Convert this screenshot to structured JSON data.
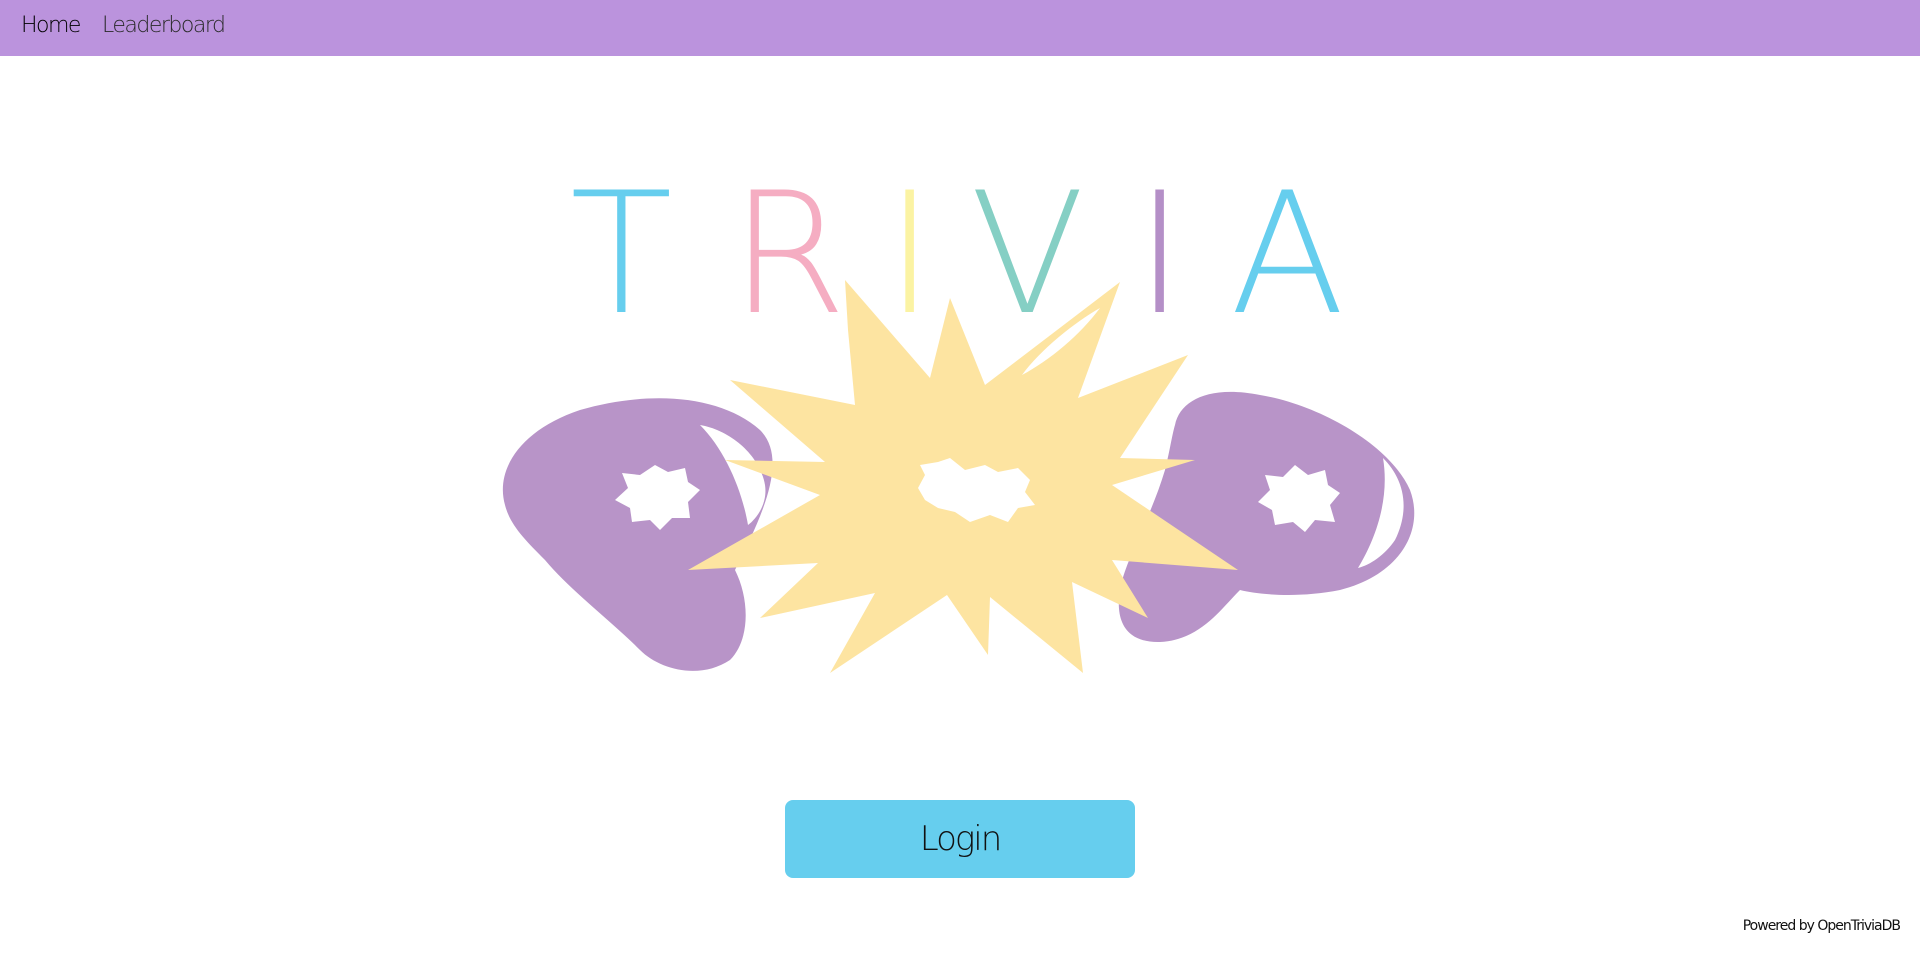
{
  "nav": {
    "home_label": "Home",
    "leaderboard_label": "Leaderboard"
  },
  "logo": {
    "letters": [
      "T",
      "R",
      "I",
      "V",
      "I",
      "A"
    ],
    "letter_colors": [
      "#66ceee",
      "#f5adc2",
      "#fbf3a3",
      "#85cfc4",
      "#b48fc7",
      "#66ceee"
    ],
    "controller_color": "#b894c8",
    "burst_color": "#fde4a1"
  },
  "login": {
    "label": "Login"
  },
  "footer": {
    "powered_by": "Powered by OpenTriviaDB"
  },
  "colors": {
    "navbar": "#bb93dd",
    "login_button": "#66ceee"
  }
}
